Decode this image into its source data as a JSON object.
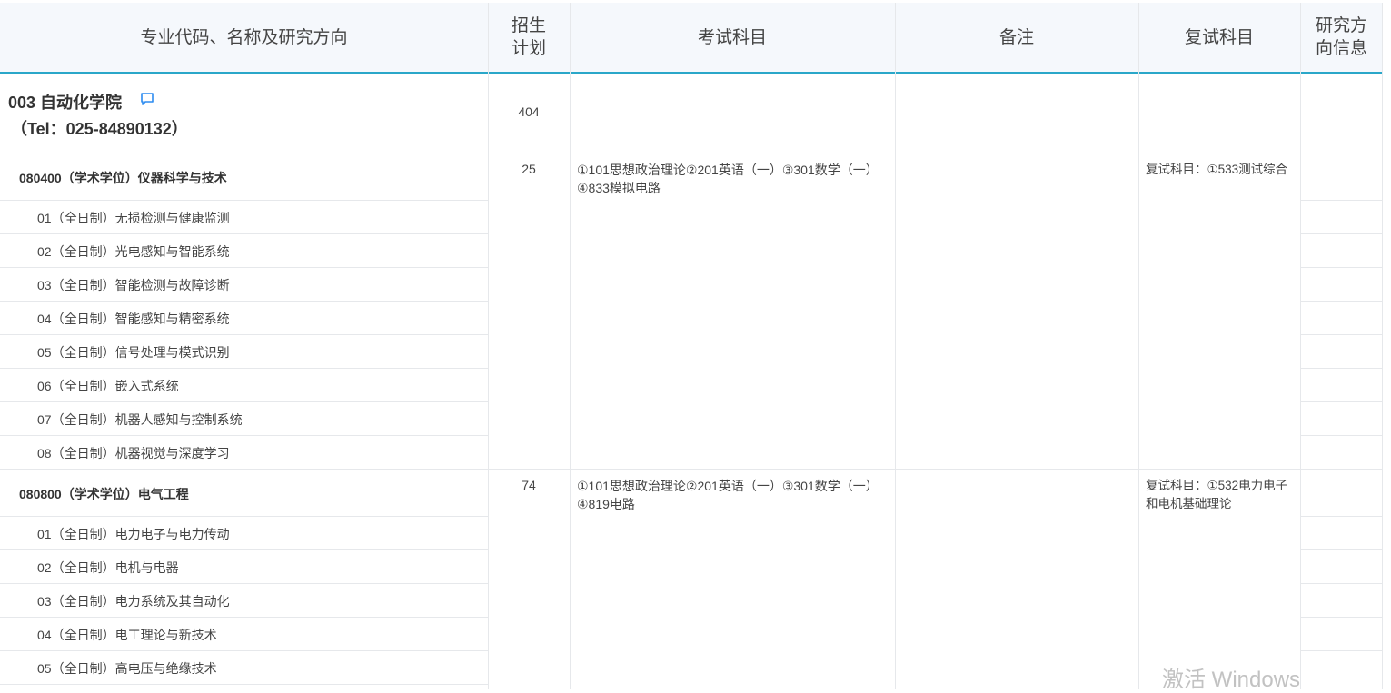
{
  "header": {
    "col_major": "专业代码、名称及研究方向",
    "col_plan": "招生计划",
    "col_exam": "考试科目",
    "col_remark": "备注",
    "col_retest": "复试科目",
    "col_info": "研究方向信息"
  },
  "department": {
    "name": "003 自动化学院",
    "tel": "（Tel：025-84890132）",
    "plan": "404",
    "icon": "comment-icon"
  },
  "majors": [
    {
      "title": "080400（学术学位）仪器科学与技术",
      "plan": "25",
      "exam": "①101思想政治理论②201英语（一）③301数学（一）④833模拟电路",
      "retest": "复试科目：①533测试综合",
      "directions": [
        "01（全日制）无损检测与健康监测",
        "02（全日制）光电感知与智能系统",
        "03（全日制）智能检测与故障诊断",
        "04（全日制）智能感知与精密系统",
        "05（全日制）信号处理与模式识别",
        "06（全日制）嵌入式系统",
        "07（全日制）机器人感知与控制系统",
        "08（全日制）机器视觉与深度学习"
      ]
    },
    {
      "title": "080800（学术学位）电气工程",
      "plan": "74",
      "exam": "①101思想政治理论②201英语（一）③301数学（一）④819电路",
      "retest": "复试科目：①532电力电子和电机基础理论",
      "directions": [
        "01（全日制）电力电子与电力传动",
        "02（全日制）电机与电器",
        "03（全日制）电力系统及其自动化",
        "04（全日制）电工理论与新技术",
        "05（全日制）高电压与绝缘技术"
      ]
    }
  ],
  "watermark": "激活 Windows"
}
